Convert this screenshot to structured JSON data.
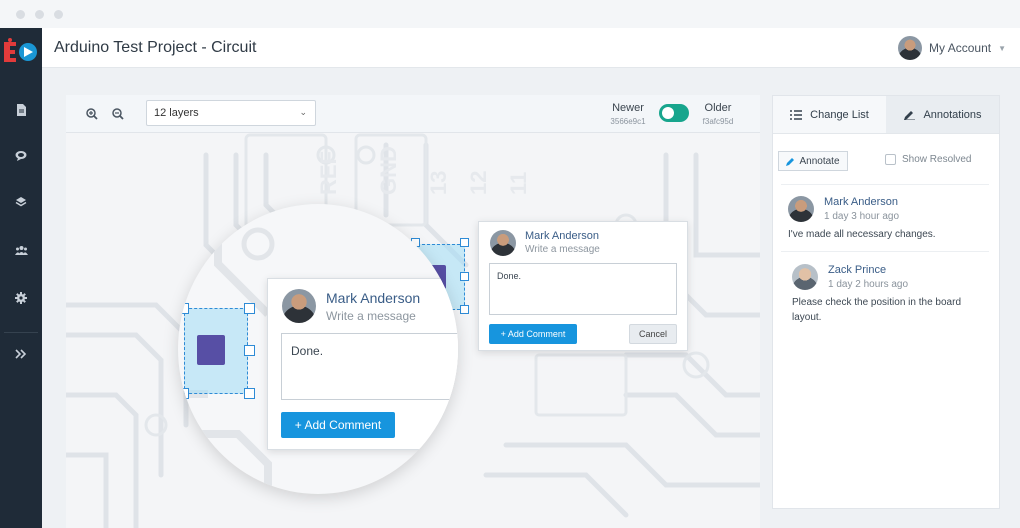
{
  "window": {
    "traffic_colors": [
      "#d9dde2",
      "#d9dde2",
      "#d9dde2"
    ]
  },
  "header": {
    "title": "Arduino Test Project - Circuit",
    "account_label": "My Account"
  },
  "sidebar": {
    "icons": [
      "document-icon",
      "chat-icon",
      "layers-icon",
      "team-icon",
      "gear-icon",
      "expand-icon"
    ]
  },
  "toolbar": {
    "layers_select": "12 layers",
    "newer_label": "Newer",
    "newer_hash": "3566e9c1",
    "older_label": "Older",
    "older_hash": "f3afc95d"
  },
  "panel": {
    "tabs": [
      {
        "label": "Change List"
      },
      {
        "label": "Annotations"
      }
    ],
    "annotate_button": "Annotate",
    "show_resolved": "Show Resolved",
    "comments": [
      {
        "author": "Mark Anderson",
        "time": "1 day 3 hour ago",
        "text": "I've made all necessary changes."
      },
      {
        "author": "Zack Prince",
        "time": "1 day 2 hours ago",
        "text": "Please check the position in the board layout."
      }
    ]
  },
  "popup_small": {
    "author": "Mark Anderson",
    "placeholder": "Write a message",
    "text": "Done.",
    "add_button": "+ Add Comment",
    "cancel_button": "Cancel"
  },
  "popup_large": {
    "author": "Mark Anderson",
    "placeholder": "Write a message",
    "text": "Done.",
    "add_button": "+ Add Comment"
  },
  "colors": {
    "accent": "#1795de",
    "toggle": "#17a58d",
    "sidebar": "#1f2b38",
    "link": "#3a5d87"
  }
}
